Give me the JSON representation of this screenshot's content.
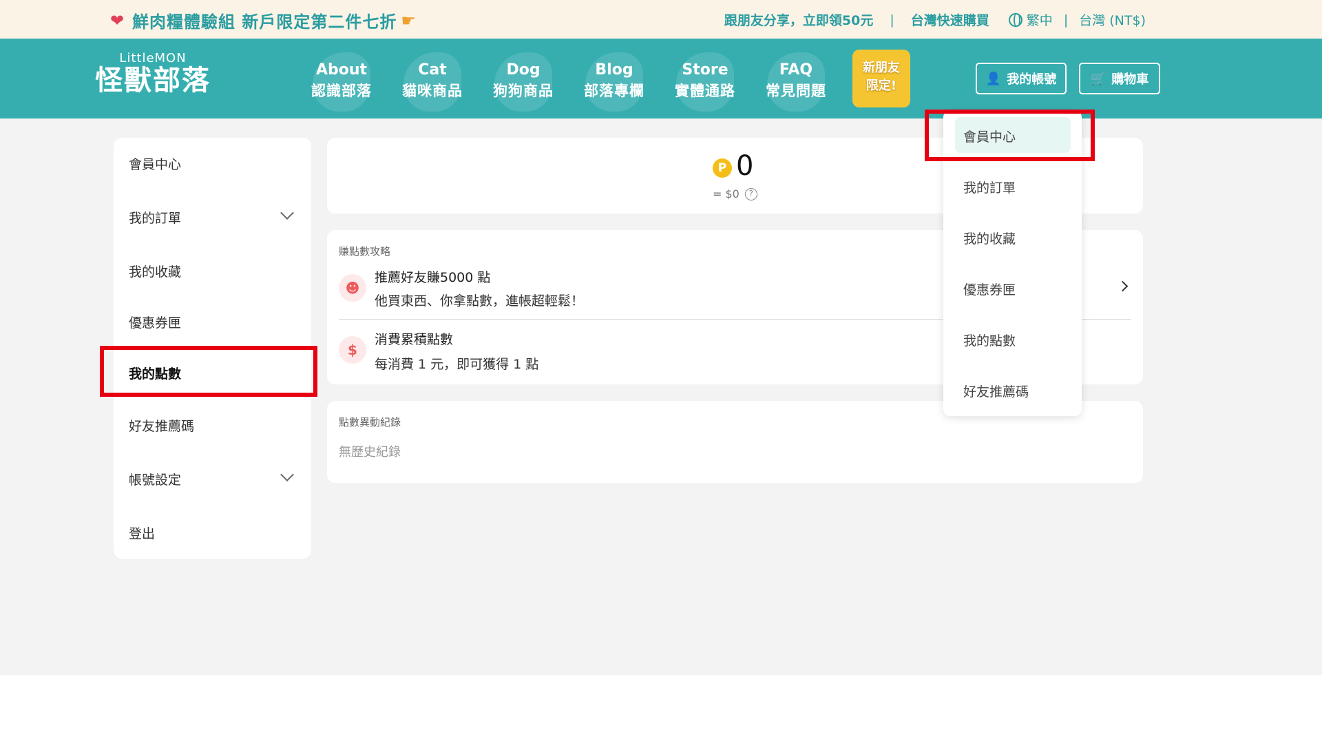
{
  "promo": {
    "left_text": "鮮肉糧體驗組 新戶限定第二件七折",
    "share": "跟朋友分享，立即領50元",
    "fast_buy": "台灣快速購買",
    "lang": "繁中",
    "region": "台灣 (NT$)",
    "heart_icon": "heart-icon",
    "hand_icon": "pointing-hand-icon"
  },
  "header": {
    "logo_small": "LittleMON",
    "logo_big": "怪獸部落",
    "nav": [
      {
        "en": "About",
        "zh": "認識部落"
      },
      {
        "en": "Cat",
        "zh": "貓咪商品"
      },
      {
        "en": "Dog",
        "zh": "狗狗商品"
      },
      {
        "en": "Blog",
        "zh": "部落專欄"
      },
      {
        "en": "Store",
        "zh": "實體通路"
      },
      {
        "en": "FAQ",
        "zh": "常見問題"
      }
    ],
    "new_friend_line1": "新朋友",
    "new_friend_line2": "限定!",
    "account": "我的帳號",
    "cart": "購物車"
  },
  "sidebar": {
    "items": [
      "會員中心",
      "我的訂單",
      "我的收藏",
      "優惠券匣",
      "我的點數",
      "好友推薦碼",
      "帳號設定",
      "登出"
    ]
  },
  "points": {
    "coin": "P",
    "value": "0",
    "money": "= $0",
    "help": "?"
  },
  "strategy": {
    "title": "賺點數攻略",
    "rows": [
      {
        "title": "推薦好友賺5000 點",
        "sub": "他買東西、你拿點數，進帳超輕鬆！",
        "icon": "chat-icon"
      },
      {
        "title": "消費累積點數",
        "sub": "每消費 1 元，即可獲得 1 點",
        "icon": "dollar-icon"
      }
    ]
  },
  "history": {
    "title": "點數異動紀錄",
    "empty": "無歷史紀錄"
  },
  "dropdown": {
    "items": [
      "會員中心",
      "我的訂單",
      "我的收藏",
      "優惠券匣",
      "我的點數",
      "好友推薦碼"
    ]
  },
  "colors": {
    "teal": "#36aeb0",
    "promo_bg": "#fbf3e6",
    "highlight": "#e60012",
    "coin": "#f5be16"
  }
}
